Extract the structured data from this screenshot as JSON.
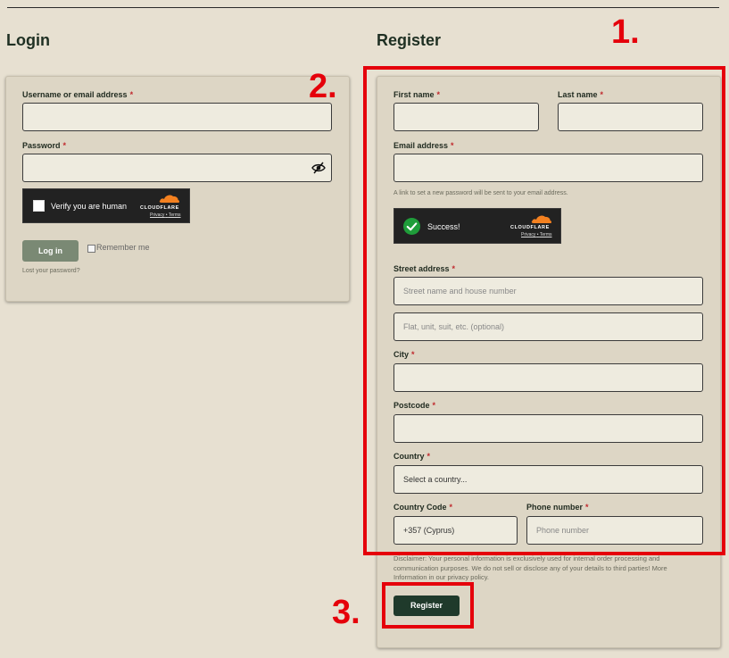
{
  "login": {
    "heading": "Login",
    "username_label": "Username or email address",
    "username_value": "",
    "password_label": "Password",
    "password_value": "",
    "captcha_text": "Verify you are human",
    "login_button": "Log in",
    "remember_label": "Remember me",
    "lost_password": "Lost your password?"
  },
  "register": {
    "heading": "Register",
    "first_name_label": "First name",
    "last_name_label": "Last name",
    "email_label": "Email address",
    "email_hint": "A link to set a new password will be sent to your email address.",
    "captcha_text": "Success!",
    "street_label": "Street address",
    "street_placeholder": "Street name and house number",
    "street2_placeholder": "Flat, unit, suit, etc. (optional)",
    "city_label": "City",
    "postcode_label": "Postcode",
    "country_label": "Country",
    "country_value": "Select a country...",
    "country_code_label": "Country Code",
    "country_code_value": "+357 (Cyprus)",
    "phone_label": "Phone number",
    "phone_placeholder": "Phone number",
    "disclaimer": "Disclaimer: Your personal information is exclusively used for internal order processing and communication purposes. We do not sell or disclose any of your details to third parties! More Information in our privacy policy.",
    "register_button": "Register"
  },
  "cloudflare": {
    "brand": "CLOUDFLARE",
    "privacy": "Privacy",
    "separator": "•",
    "terms": "Terms"
  },
  "required_mark": "*",
  "annotations": {
    "one": "1.",
    "two": "2.",
    "three": "3."
  },
  "colors": {
    "background": "#e7e0d1",
    "card": "#ddd6c5",
    "primary_button": "#1f3a2b",
    "login_button": "#7a8974",
    "required": "#c0282d",
    "annotation_red": "#e5000b",
    "cloudflare_orange": "#f48120",
    "success_green": "#1f9d3a"
  }
}
